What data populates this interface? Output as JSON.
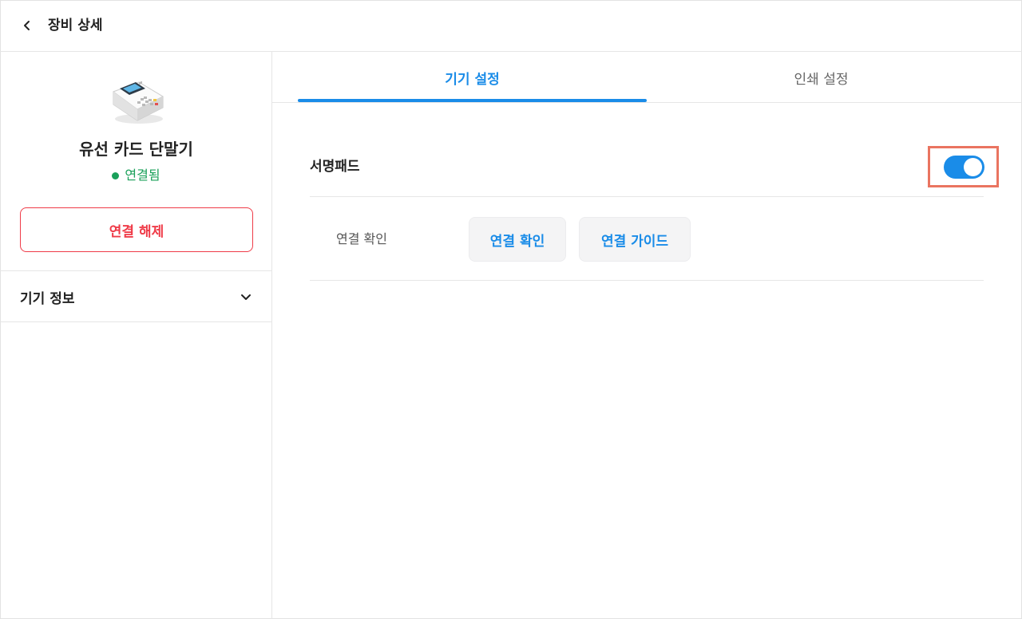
{
  "header": {
    "title": "장비 상세",
    "back_icon": "chevron-left-icon"
  },
  "sidebar": {
    "device_name": "유선 카드 단말기",
    "status": "연결됨",
    "status_color": "#1aa05a",
    "disconnect_label": "연결 해제",
    "device_info_label": "기기 정보",
    "device_info_icon": "chevron-down-icon"
  },
  "tabs": [
    {
      "label": "기기 설정",
      "active": true
    },
    {
      "label": "인쇄 설정",
      "active": false
    }
  ],
  "settings": {
    "signpad_label": "서명패드",
    "signpad_enabled": true,
    "connection_label": "연결 확인",
    "check_button": "연결 확인",
    "guide_button": "연결 가이드"
  },
  "colors": {
    "accent": "#1a8ce8",
    "danger": "#ef3b48",
    "highlight": "#ea7460"
  }
}
